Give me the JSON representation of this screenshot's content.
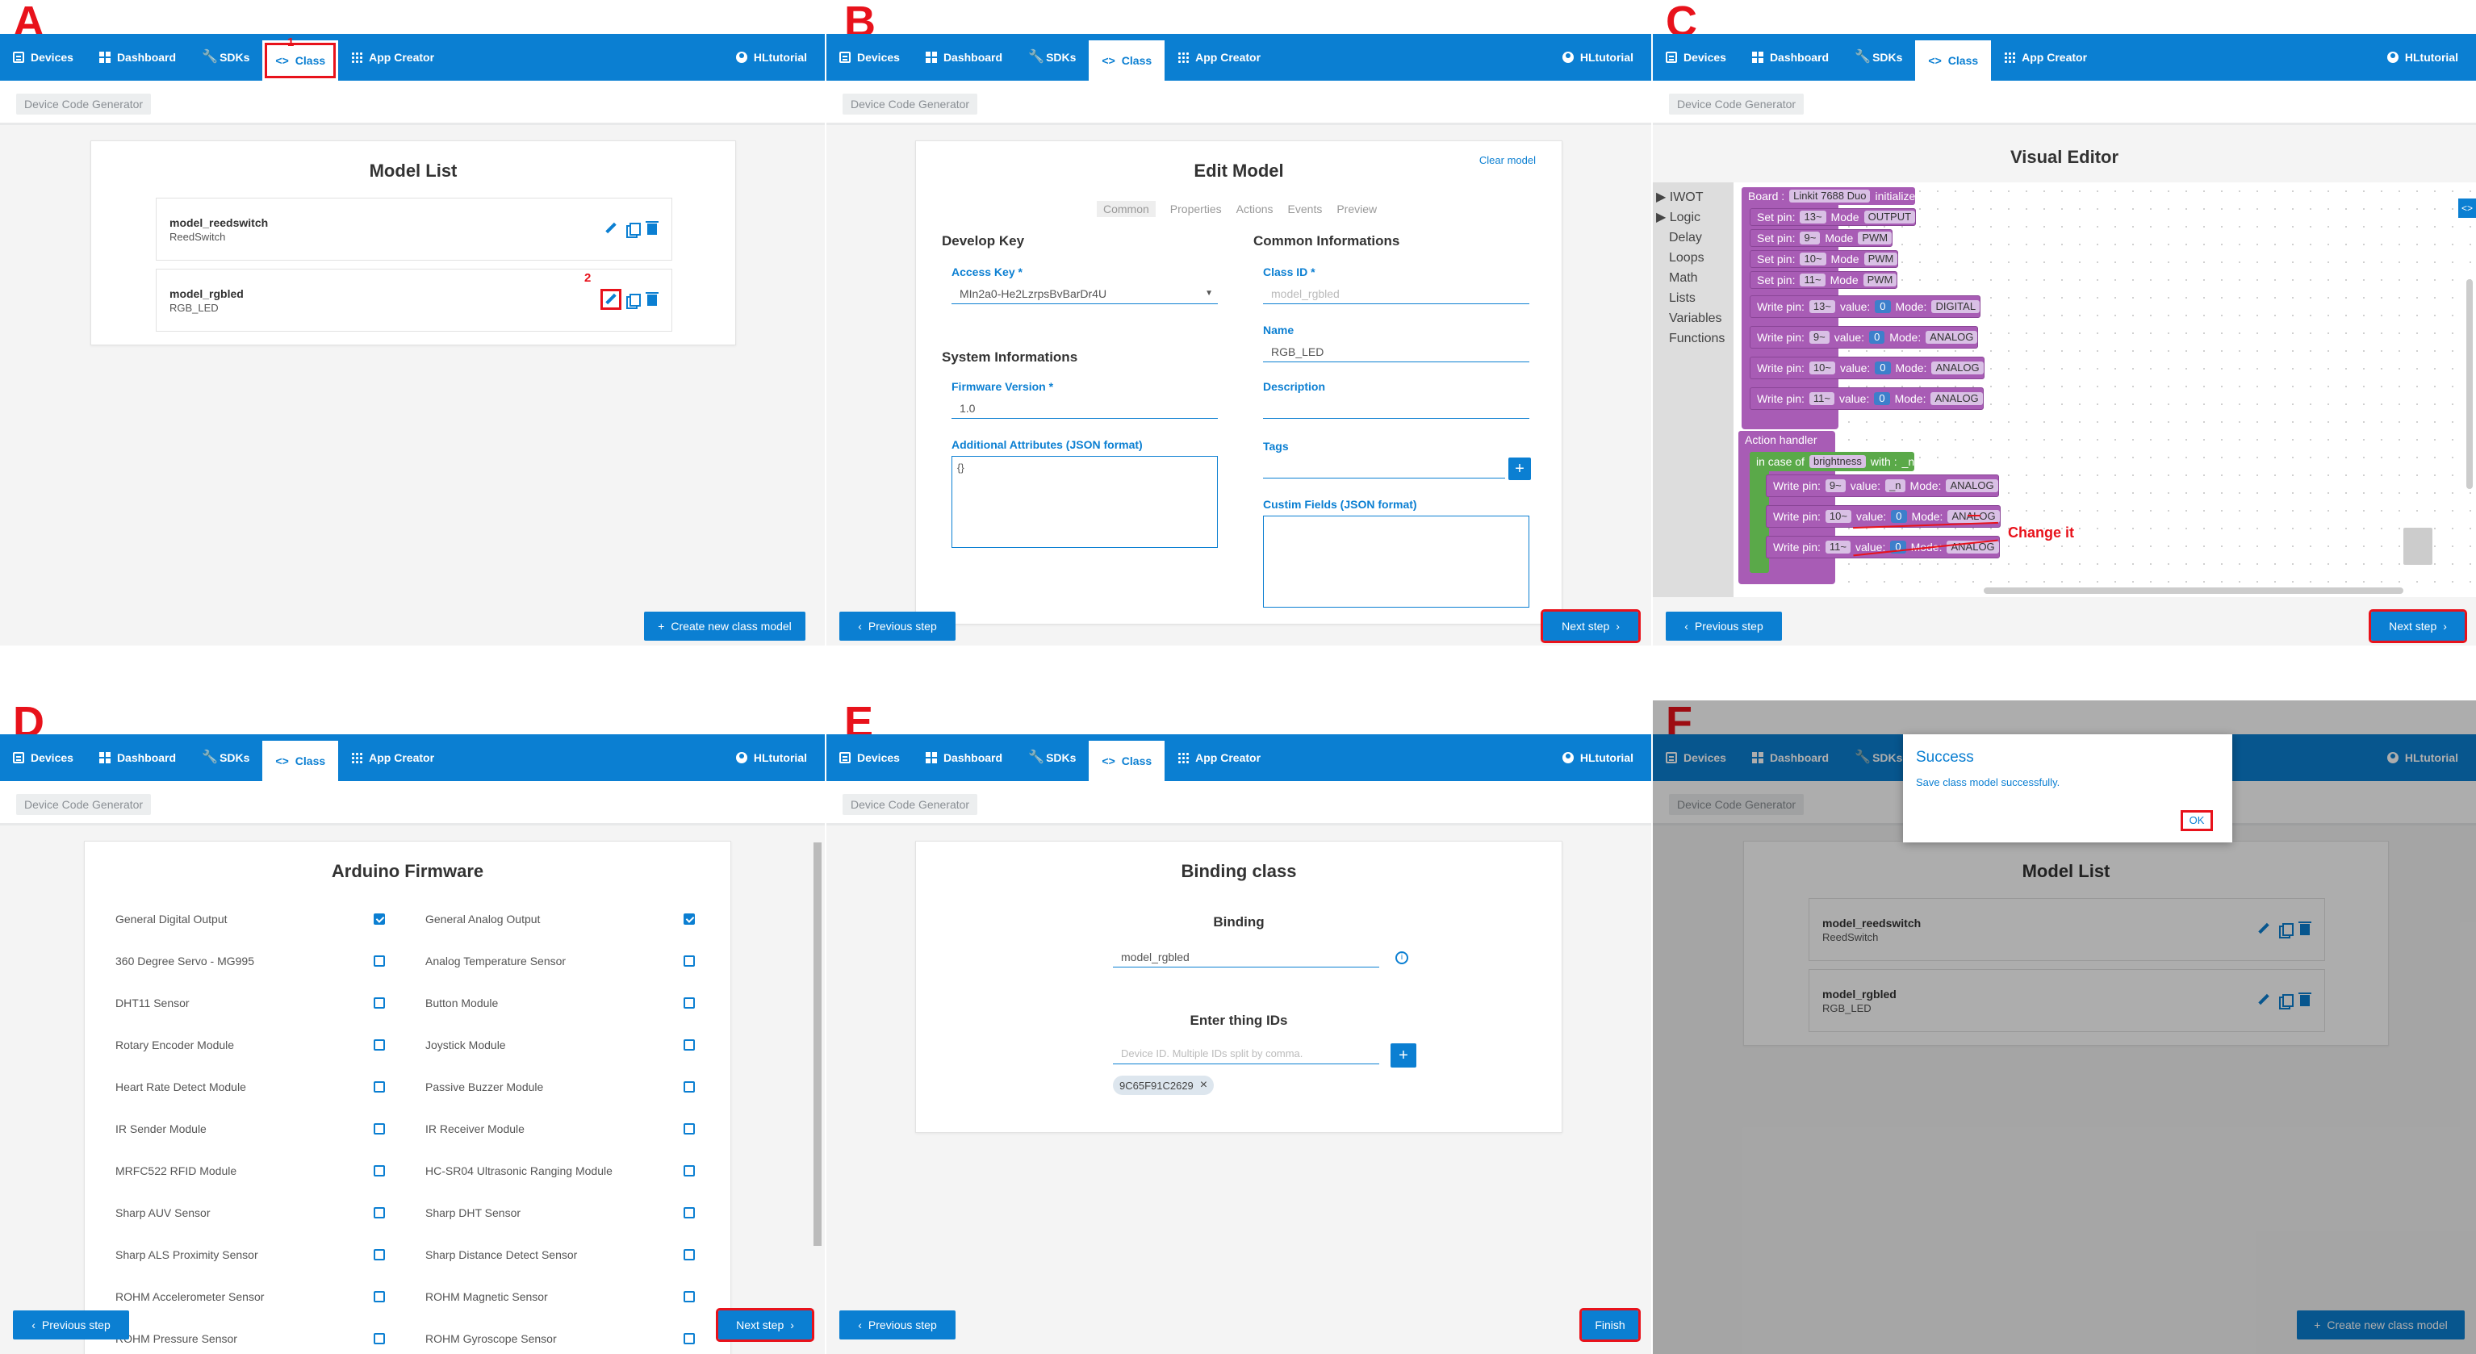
{
  "nav": {
    "devices": "Devices",
    "dashboard": "Dashboard",
    "sdks": "SDKs",
    "class": "Class",
    "app_creator": "App Creator",
    "user": "HLtutorial"
  },
  "breadcrumb": "Device Code Generator",
  "labels": {
    "a": "A",
    "b": "B",
    "c": "C",
    "d": "D",
    "e": "E",
    "f": "F"
  },
  "annotations": {
    "step1": "1",
    "step2": "2",
    "change_it": "Change it"
  },
  "buttons": {
    "create_new": "Create new class model",
    "previous": "Previous step",
    "next": "Next step",
    "finish": "Finish"
  },
  "panel_a": {
    "title": "Model List",
    "models": [
      {
        "name": "model_reedswitch",
        "sub": "ReedSwitch"
      },
      {
        "name": "model_rgbled",
        "sub": "RGB_LED"
      }
    ]
  },
  "panel_b": {
    "title": "Edit Model",
    "clear": "Clear model",
    "tabs": [
      "Common",
      "Properties",
      "Actions",
      "Events",
      "Preview"
    ],
    "develop_key": "Develop Key",
    "access_key_label": "Access Key *",
    "access_key": "MIn2a0-He2LzrpsBvBarDr4U",
    "system_info": "System Informations",
    "fw_label": "Firmware Version *",
    "fw": "1.0",
    "attr_label": "Additional Attributes (JSON format)",
    "attr": "{}",
    "common_info": "Common Informations",
    "class_id_label": "Class ID *",
    "class_id": "model_rgbled",
    "name_label": "Name",
    "name": "RGB_LED",
    "desc_label": "Description",
    "tags_label": "Tags",
    "custom_label": "Custim Fields (JSON format)"
  },
  "panel_c": {
    "title": "Visual Editor",
    "categories": [
      "IWOT",
      "Logic",
      "Delay",
      "Loops",
      "Math",
      "Lists",
      "Variables",
      "Functions"
    ],
    "board": "Board :",
    "board_val": "Linkit 7688 Duo",
    "initialize": "initialize",
    "set_pin": "Set pin:",
    "mode": "Mode",
    "write_pin": "Write pin:",
    "value": "value:",
    "mode2": "Mode:",
    "setpins": [
      {
        "pin": "13~",
        "mode": "OUTPUT"
      },
      {
        "pin": "9~",
        "mode": "PWM"
      },
      {
        "pin": "10~",
        "mode": "PWM"
      },
      {
        "pin": "11~",
        "mode": "PWM"
      }
    ],
    "writepins": [
      {
        "pin": "13~",
        "val": "0",
        "mode": "DIGITAL"
      },
      {
        "pin": "9~",
        "val": "0",
        "mode": "ANALOG"
      },
      {
        "pin": "10~",
        "val": "0",
        "mode": "ANALOG"
      },
      {
        "pin": "11~",
        "val": "0",
        "mode": "ANALOG"
      }
    ],
    "action_handler": "Action handler",
    "in_case_of": "in case of",
    "brightness": "brightness",
    "with": "with :",
    "n": "_n",
    "handler_pins": [
      {
        "pin": "9~",
        "val": "_n",
        "mode": "ANALOG"
      },
      {
        "pin": "10~",
        "val": "0",
        "mode": "ANALOG"
      },
      {
        "pin": "11~",
        "val": "0",
        "mode": "ANALOG"
      }
    ]
  },
  "panel_d": {
    "title": "Arduino Firmware",
    "items": [
      {
        "l": "General Digital Output",
        "lc": true,
        "r": "General Analog Output",
        "rc": true
      },
      {
        "l": "360 Degree Servo - MG995",
        "lc": false,
        "r": "Analog Temperature Sensor",
        "rc": false
      },
      {
        "l": "DHT11 Sensor",
        "lc": false,
        "r": "Button Module",
        "rc": false
      },
      {
        "l": "Rotary Encoder Module",
        "lc": false,
        "r": "Joystick Module",
        "rc": false
      },
      {
        "l": "Heart Rate Detect Module",
        "lc": false,
        "r": "Passive Buzzer Module",
        "rc": false
      },
      {
        "l": "IR Sender Module",
        "lc": false,
        "r": "IR Receiver Module",
        "rc": false
      },
      {
        "l": "MRFC522 RFID Module",
        "lc": false,
        "r": "HC-SR04 Ultrasonic Ranging Module",
        "rc": false
      },
      {
        "l": "Sharp AUV Sensor",
        "lc": false,
        "r": "Sharp DHT Sensor",
        "rc": false
      },
      {
        "l": "Sharp ALS Proximity Sensor",
        "lc": false,
        "r": "Sharp Distance Detect Sensor",
        "rc": false
      },
      {
        "l": "ROHM Accelerometer Sensor",
        "lc": false,
        "r": "ROHM Magnetic Sensor",
        "rc": false
      },
      {
        "l": "ROHM Pressure Sensor",
        "lc": false,
        "r": "ROHM Gyroscope Sensor",
        "rc": false
      }
    ]
  },
  "panel_e": {
    "title": "Binding class",
    "binding": "Binding",
    "binding_val": "model_rgbled",
    "thing_ids": "Enter thing IDs",
    "placeholder": "Device ID. Multiple IDs split by comma.",
    "chip": "9C65F91C2629"
  },
  "panel_f": {
    "dialog_title": "Success",
    "dialog_msg": "Save class model successfully.",
    "ok": "OK",
    "title": "Model List",
    "models": [
      {
        "name": "model_reedswitch",
        "sub": "ReedSwitch"
      },
      {
        "name": "model_rgbled",
        "sub": "RGB_LED"
      }
    ]
  }
}
